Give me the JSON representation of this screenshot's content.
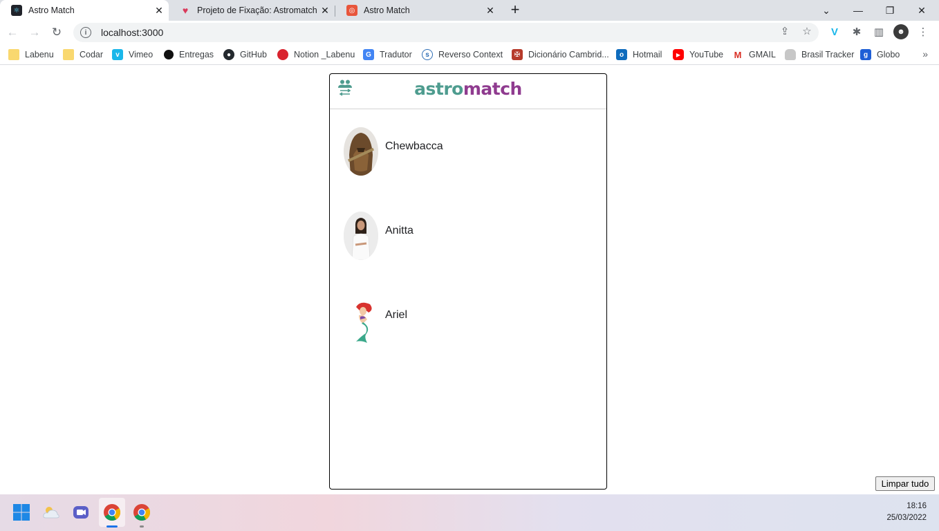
{
  "browser": {
    "tabs": [
      {
        "title": "Astro Match",
        "active": true
      },
      {
        "title": "Projeto de Fixação: Astromatch",
        "active": false
      },
      {
        "title": "Astro Match",
        "active": false
      }
    ],
    "url": "localhost:3000"
  },
  "bookmarks": [
    {
      "label": "Labenu",
      "icon": "folder-icon"
    },
    {
      "label": "Codar",
      "icon": "folder-icon"
    },
    {
      "label": "Vimeo",
      "icon": "vimeo-icon"
    },
    {
      "label": "Entregas",
      "icon": "circle-icon"
    },
    {
      "label": "GitHub",
      "icon": "github-icon"
    },
    {
      "label": "Notion _Labenu",
      "icon": "apple-icon"
    },
    {
      "label": "Tradutor",
      "icon": "translate-icon"
    },
    {
      "label": "Reverso Context",
      "icon": "reverso-icon"
    },
    {
      "label": "Dicionário Cambrid...",
      "icon": "cambridge-icon"
    },
    {
      "label": "Hotmail",
      "icon": "outlook-icon"
    },
    {
      "label": "YouTube",
      "icon": "youtube-icon"
    },
    {
      "label": "GMAIL",
      "icon": "gmail-icon"
    },
    {
      "label": "Brasil Tracker",
      "icon": "lock-icon"
    },
    {
      "label": "Globo",
      "icon": "globo-icon"
    }
  ],
  "app": {
    "logo_part1": "astro",
    "logo_part2": "match",
    "matches": [
      {
        "name": "Chewbacca"
      },
      {
        "name": "Anitta"
      },
      {
        "name": "Ariel"
      }
    ],
    "clear_button": "Limpar tudo"
  },
  "taskbar": {
    "time": "18:16",
    "date": "25/03/2022"
  },
  "colors": {
    "logo_teal": "#4e9c8f",
    "logo_purple": "#8f3b8f"
  }
}
